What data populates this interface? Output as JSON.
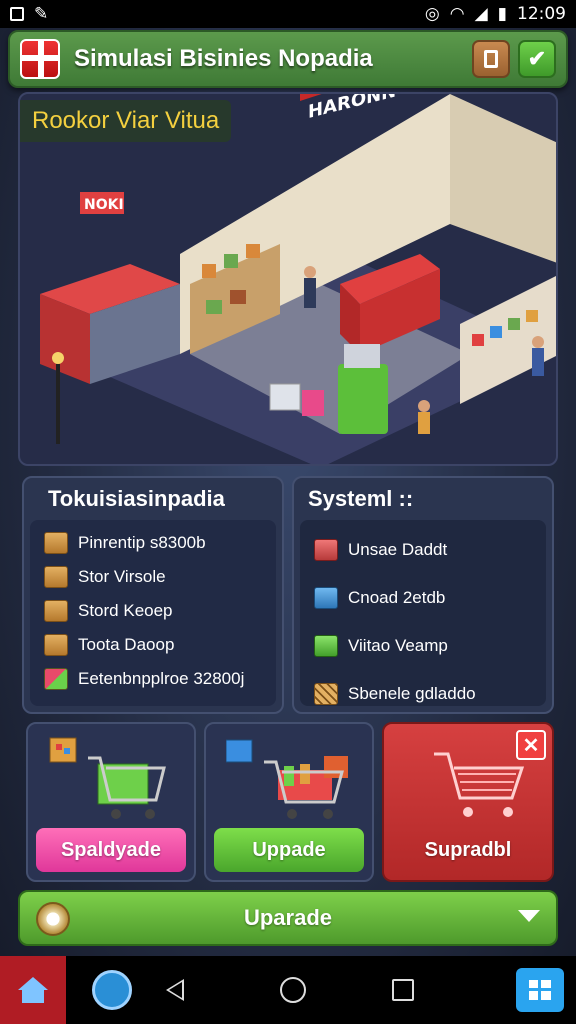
{
  "status_bar": {
    "time": "12:09"
  },
  "header": {
    "title": "Simulasi Bisinies Nopadia"
  },
  "scene": {
    "label": "Rookor Viar Vitua",
    "sign_left": "NOKI",
    "sign_center": "HARONN"
  },
  "panel_left": {
    "title": "Tokuisiasinpadia",
    "items": [
      {
        "label": "Pinrentip s8300b",
        "icon": "boxes-icon"
      },
      {
        "label": "Stor Virsole",
        "icon": "box-icon"
      },
      {
        "label": "Stord Keoep",
        "icon": "box-icon"
      },
      {
        "label": "Toota Daoop",
        "icon": "box-icon"
      },
      {
        "label": "Eetenbnpplroe 32800j",
        "icon": "product-icon"
      }
    ]
  },
  "panel_right": {
    "title": "Systeml ::",
    "items": [
      {
        "label": "Unsae Daddt",
        "icon": "red-box-icon"
      },
      {
        "label": "Cnoad 2etdb",
        "icon": "blue-box-icon"
      },
      {
        "label": "Viitao Veamp",
        "icon": "green-box-icon"
      },
      {
        "label": "Sbenele gdladdo",
        "icon": "grid-icon"
      }
    ]
  },
  "cards": [
    {
      "button": "Spaldyade",
      "color": "#e0379a"
    },
    {
      "button": "Uppade",
      "color": "#4aa62c"
    },
    {
      "button": "Supradbl",
      "color": "#b22828",
      "close": "✕"
    }
  ],
  "upgrade": {
    "label": "Uparade"
  },
  "colors": {
    "accent_green": "#4e9a2c",
    "title_bar": "#3f7a36",
    "label_yellow": "#f4d03f"
  }
}
